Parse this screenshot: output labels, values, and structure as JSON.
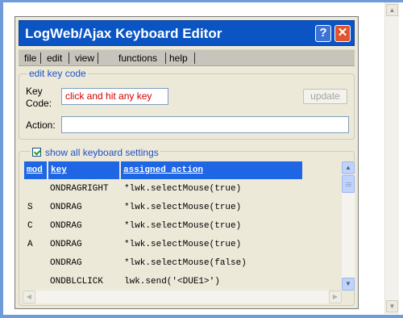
{
  "window": {
    "title": "LogWeb/Ajax Keyboard Editor"
  },
  "titlebar_buttons": {
    "help": "?",
    "close": "✕"
  },
  "menu": {
    "items": [
      {
        "label": "file"
      },
      {
        "label": "edit"
      },
      {
        "label": "view"
      },
      {
        "label": "functions"
      },
      {
        "label": "help"
      }
    ]
  },
  "edit_group": {
    "legend": "edit key code",
    "key_label_line1": "Key",
    "key_label_line2": "Code:",
    "key_code_placeholder": "click and hit any key",
    "update_button": "update",
    "action_label": "Action:",
    "action_value": ""
  },
  "settings_group": {
    "checkbox_label": "show all keyboard settings",
    "checkbox_checked": true,
    "columns": {
      "mod": "mod",
      "key": "key",
      "action": "assigned action"
    },
    "rows": [
      {
        "mod": "",
        "key": "ONDRAGRIGHT",
        "action": "*lwk.selectMouse(true)"
      },
      {
        "mod": "S",
        "key": "ONDRAG",
        "action": "*lwk.selectMouse(true)"
      },
      {
        "mod": "C",
        "key": "ONDRAG",
        "action": "*lwk.selectMouse(true)"
      },
      {
        "mod": "A",
        "key": "ONDRAG",
        "action": "*lwk.selectMouse(true)"
      },
      {
        "mod": "",
        "key": "ONDRAG",
        "action": "*lwk.selectMouse(false)"
      },
      {
        "mod": "",
        "key": "ONDBLCLICK",
        "action": "lwk.send('<DUE1>')"
      }
    ]
  },
  "icons": {
    "help": "help-icon",
    "close": "close-icon",
    "scroll_up": "arrow-up-icon",
    "scroll_down": "arrow-down-icon",
    "scroll_left": "arrow-left-icon",
    "scroll_right": "arrow-right-icon",
    "checkbox": "checkmark-icon"
  },
  "colors": {
    "titlebar": "#0a54c4",
    "table_header": "#1f66e5",
    "legend_text": "#2050c8",
    "key_code_text": "#d40000"
  }
}
